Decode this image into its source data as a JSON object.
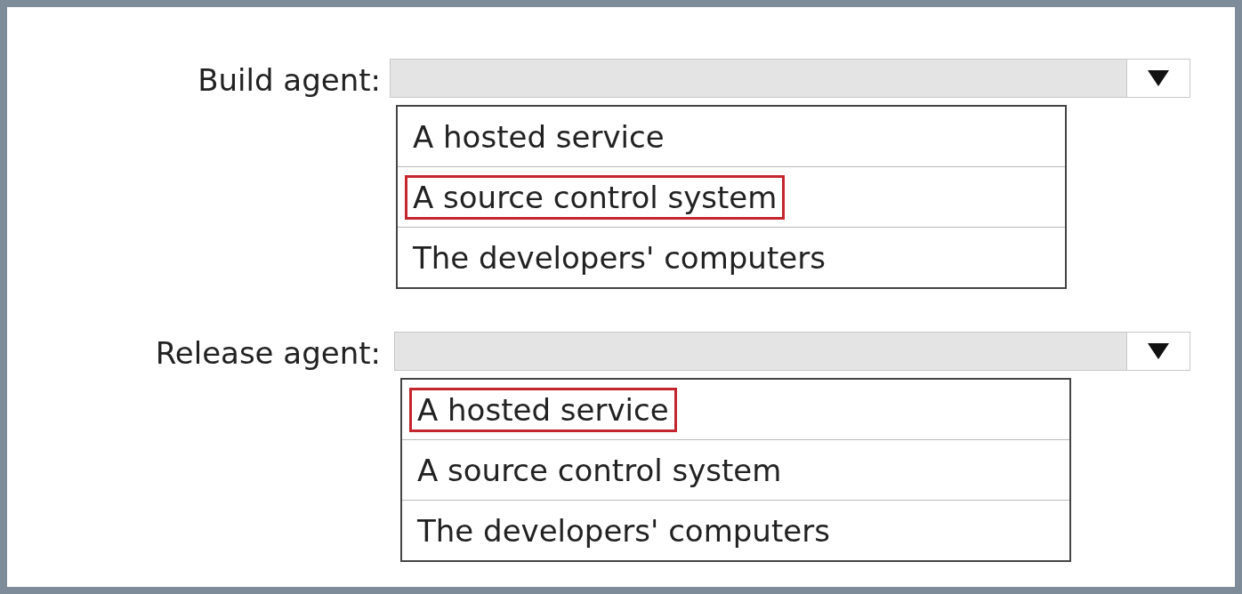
{
  "questions": [
    {
      "label": "Build agent:",
      "options": [
        {
          "text": "A hosted service",
          "selected": false
        },
        {
          "text": "A source control system",
          "selected": true
        },
        {
          "text": "The developers' computers",
          "selected": false
        }
      ]
    },
    {
      "label": "Release agent:",
      "options": [
        {
          "text": "A hosted service",
          "selected": true
        },
        {
          "text": "A source control system",
          "selected": false
        },
        {
          "text": "The developers' computers",
          "selected": false
        }
      ]
    }
  ]
}
